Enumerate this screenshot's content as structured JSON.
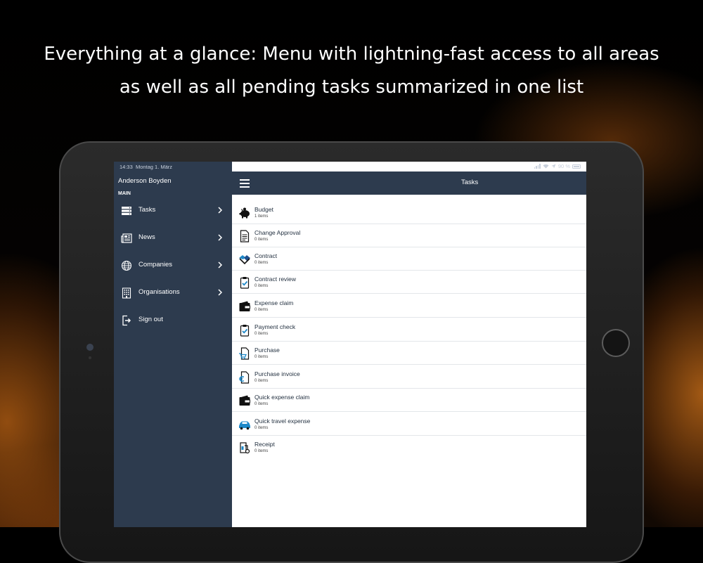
{
  "headline": {
    "line1": "Everything at a glance: Menu with lightning-fast access to all areas",
    "line2": "as well as all pending tasks summarized in one list"
  },
  "statusbar": {
    "time": "14:33",
    "date": "Montag 1. März",
    "battery": "90 %"
  },
  "sidebar": {
    "user_name": "Anderson Boyden",
    "section": "MAIN",
    "items": [
      {
        "label": "Tasks",
        "icon": "server-icon",
        "has_chevron": true
      },
      {
        "label": "News",
        "icon": "newspaper-icon",
        "has_chevron": true
      },
      {
        "label": "Companies",
        "icon": "globe-icon",
        "has_chevron": true
      },
      {
        "label": "Organisations",
        "icon": "building-icon",
        "has_chevron": true
      },
      {
        "label": "Sign out",
        "icon": "sign-out-icon",
        "has_chevron": false
      }
    ]
  },
  "topbar": {
    "title": "Tasks",
    "menu_icon": "hamburger-icon"
  },
  "tasks": [
    {
      "title": "Budget",
      "count": "1 items",
      "icon": "piggy-bank-icon"
    },
    {
      "title": "Change Approval",
      "count": "0 items",
      "icon": "document-icon"
    },
    {
      "title": "Contract",
      "count": "0 items",
      "icon": "handshake-icon"
    },
    {
      "title": "Contract review",
      "count": "0 items",
      "icon": "clipboard-check-icon"
    },
    {
      "title": "Expense claim",
      "count": "0 items",
      "icon": "wallet-icon"
    },
    {
      "title": "Payment check",
      "count": "0 items",
      "icon": "clipboard-check-icon"
    },
    {
      "title": "Purchase",
      "count": "0 items",
      "icon": "cart-document-icon"
    },
    {
      "title": "Purchase invoice",
      "count": "0 items",
      "icon": "euro-document-icon"
    },
    {
      "title": "Quick expense claim",
      "count": "0 items",
      "icon": "wallet-icon"
    },
    {
      "title": "Quick travel expense",
      "count": "0 items",
      "icon": "car-icon"
    },
    {
      "title": "Receipt",
      "count": "0 items",
      "icon": "receipt-icon"
    }
  ],
  "colors": {
    "navy": "#2d3b4e",
    "accent_blue": "#1e88c8",
    "text_dark": "#1f2d3d"
  }
}
